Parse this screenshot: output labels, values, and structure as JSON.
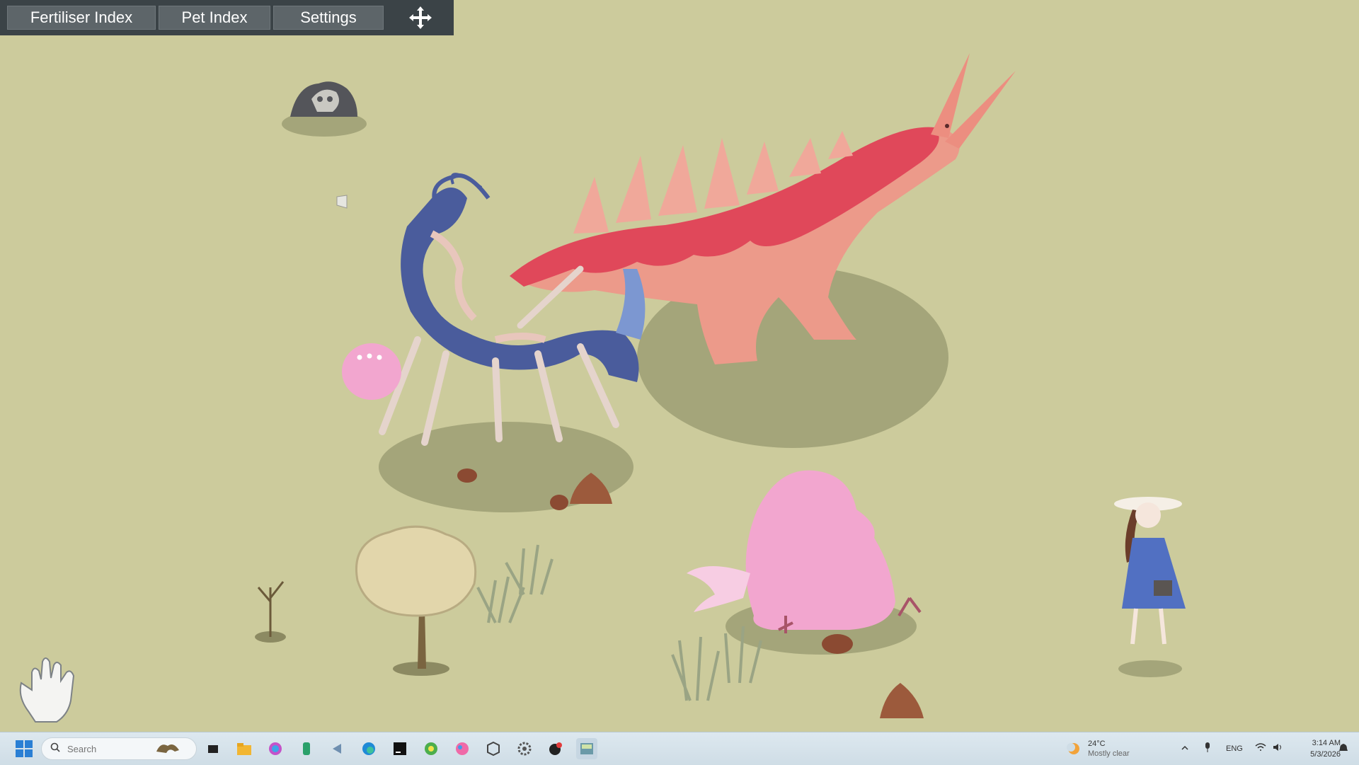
{
  "toolbar": {
    "buttons": [
      {
        "label": "Fertiliser Index"
      },
      {
        "label": "Pet Index"
      },
      {
        "label": "Settings"
      }
    ],
    "move_icon": "move-arrows-icon"
  },
  "taskbar": {
    "search_placeholder": "Search",
    "apps": [
      "start-icon",
      "search-icon",
      "widget-icon",
      "task-view-icon",
      "file-explorer-icon",
      "copilot-icon",
      "app-3-icon",
      "arrow-app-icon",
      "edge-icon",
      "pycharm-icon",
      "chat-app-icon",
      "paint-icon",
      "cube-app-icon",
      "settings-gear-icon",
      "media-app-icon",
      "game-window-icon"
    ],
    "weather_temp": "24°C",
    "weather_desc": "Mostly clear",
    "language": "ENG",
    "time": "3:14 AM",
    "date": "5/3/2026"
  },
  "colors": {
    "background": "#cccb9c",
    "toolbar_bg": "#3b4347",
    "toolbar_button": "#5d6569",
    "red_creature": "#e0485a",
    "blue_creature": "#4a5c9c",
    "pink_creature": "#f2a6cf"
  }
}
